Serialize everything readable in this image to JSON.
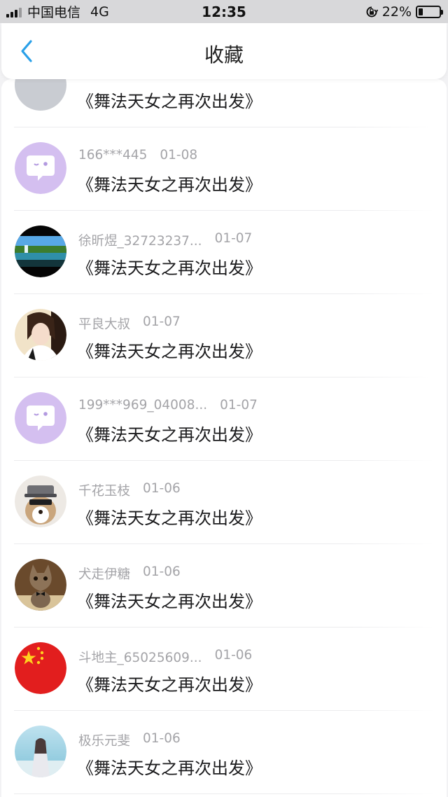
{
  "status_bar": {
    "carrier": "中国电信",
    "network": "4G",
    "time": "12:35",
    "battery": "22%",
    "battery_level": 0.22
  },
  "nav": {
    "title": "收藏",
    "back_icon": "chevron-left-icon",
    "accent_color": "#2aa0e8"
  },
  "favorites": [
    {
      "user": "",
      "date": "",
      "title": "《舞法天女之再次出发》",
      "avatar": "gray-placeholder"
    },
    {
      "user": "166***445",
      "date": "01-08",
      "title": "《舞法天女之再次出发》",
      "avatar": "purple-chat-bubble"
    },
    {
      "user": "徐昕煜_32723237...",
      "date": "01-07",
      "title": "《舞法天女之再次出发》",
      "avatar": "waterfall-landscape"
    },
    {
      "user": "平良大叔",
      "date": "01-07",
      "title": "《舞法天女之再次出发》",
      "avatar": "girl-photo"
    },
    {
      "user": "199***969_04008...",
      "date": "01-07",
      "title": "《舞法天女之再次出发》",
      "avatar": "purple-chat-bubble"
    },
    {
      "user": "千花玉枝",
      "date": "01-06",
      "title": "《舞法天女之再次出发》",
      "avatar": "dog-with-hat"
    },
    {
      "user": "犬走伊糖",
      "date": "01-06",
      "title": "《舞法天女之再次出发》",
      "avatar": "kitten-photo"
    },
    {
      "user": "斗地主_65025609...",
      "date": "01-06",
      "title": "《舞法天女之再次出发》",
      "avatar": "china-flag"
    },
    {
      "user": "极乐元斐",
      "date": "01-06",
      "title": "《舞法天女之再次出发》",
      "avatar": "girl-seaside"
    }
  ]
}
